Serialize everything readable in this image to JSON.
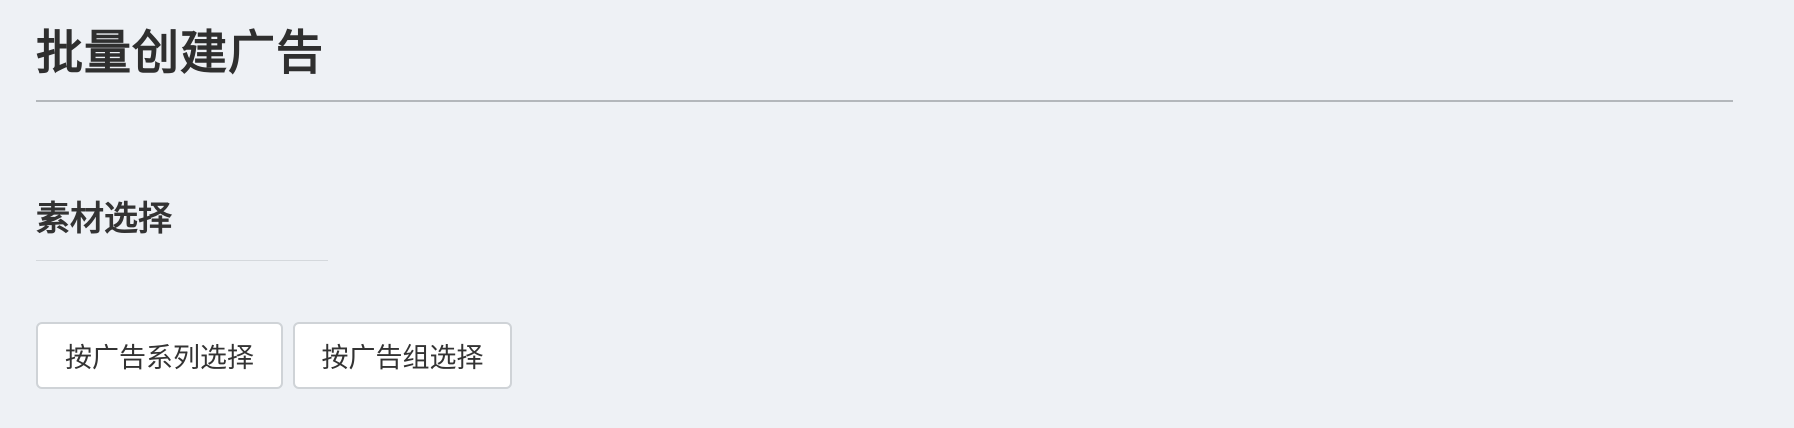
{
  "page": {
    "title": "批量创建广告"
  },
  "material_section": {
    "title": "素材选择",
    "buttons": [
      {
        "label": "按广告系列选择"
      },
      {
        "label": "按广告组选择"
      }
    ]
  },
  "colors": {
    "background": "#eef1f5",
    "text": "#333333",
    "button_border": "#cfd3d7",
    "button_background": "#ffffff"
  }
}
